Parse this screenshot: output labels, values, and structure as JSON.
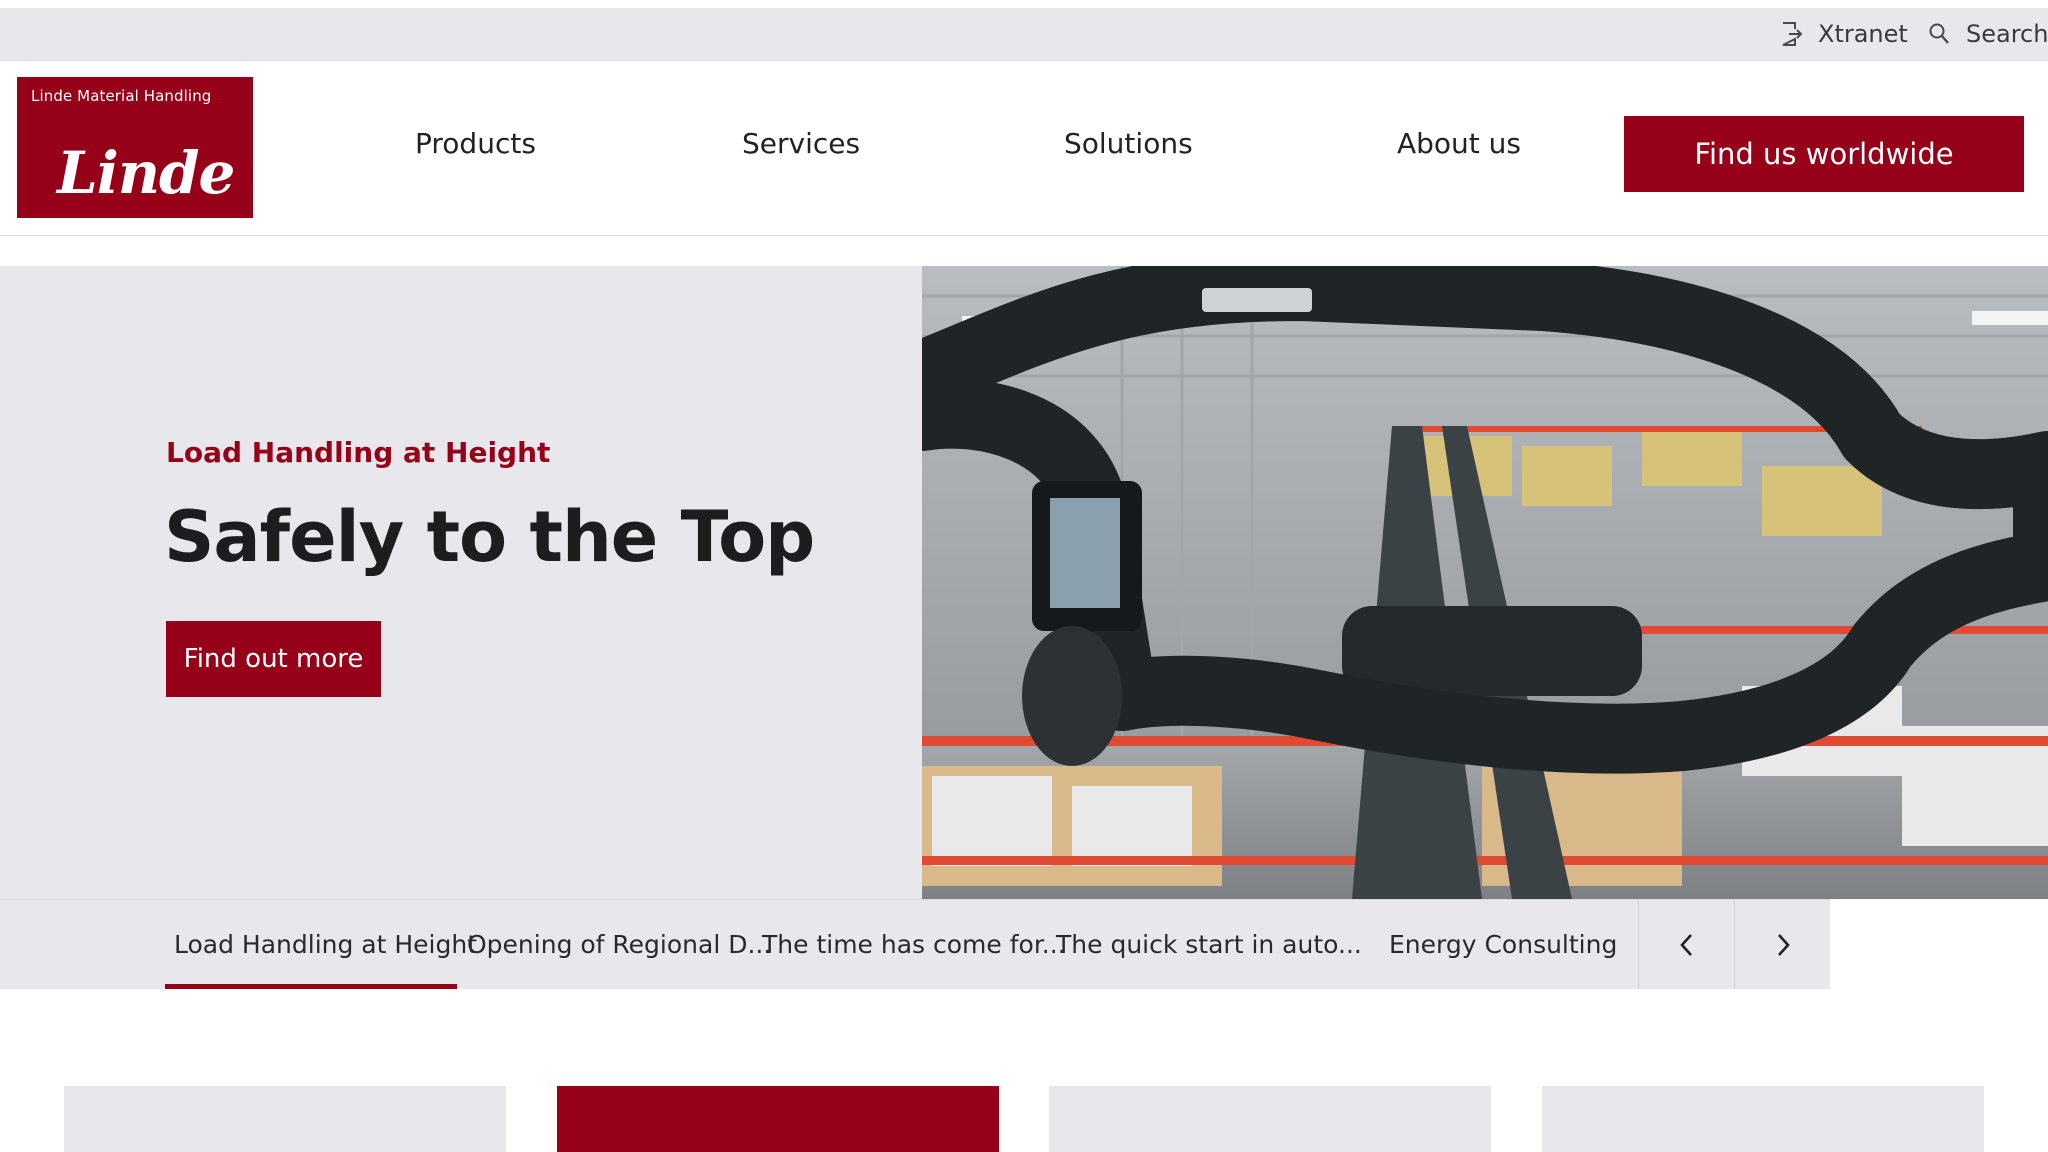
{
  "utility_bar": {
    "xtranet_label": "Xtranet",
    "search_label": "Search"
  },
  "logo": {
    "tagline": "Linde Material Handling",
    "wordmark": "Linde"
  },
  "nav": {
    "items": [
      {
        "label": "Products"
      },
      {
        "label": "Services"
      },
      {
        "label": "Solutions"
      },
      {
        "label": "About us"
      }
    ],
    "cta_label": "Find us worldwide"
  },
  "hero": {
    "eyebrow": "Load Handling at Height",
    "title": "Safely to the Top",
    "button_label": "Find out more",
    "image_icon": "forklift-cabin-warehouse-photo"
  },
  "slider_tabs": {
    "items": [
      {
        "label": "Load Handling at Height"
      },
      {
        "label": "Opening of Regional D..."
      },
      {
        "label": "The time has come for..."
      },
      {
        "label": "The quick start in auto..."
      },
      {
        "label": "Energy Consulting"
      }
    ],
    "active_index": 0,
    "prev_icon": "chevron-left-icon",
    "next_icon": "chevron-right-icon"
  },
  "colors": {
    "brand_red": "#970019",
    "panel_grey": "#e8e8ec",
    "text_dark": "#1d1d1f"
  }
}
